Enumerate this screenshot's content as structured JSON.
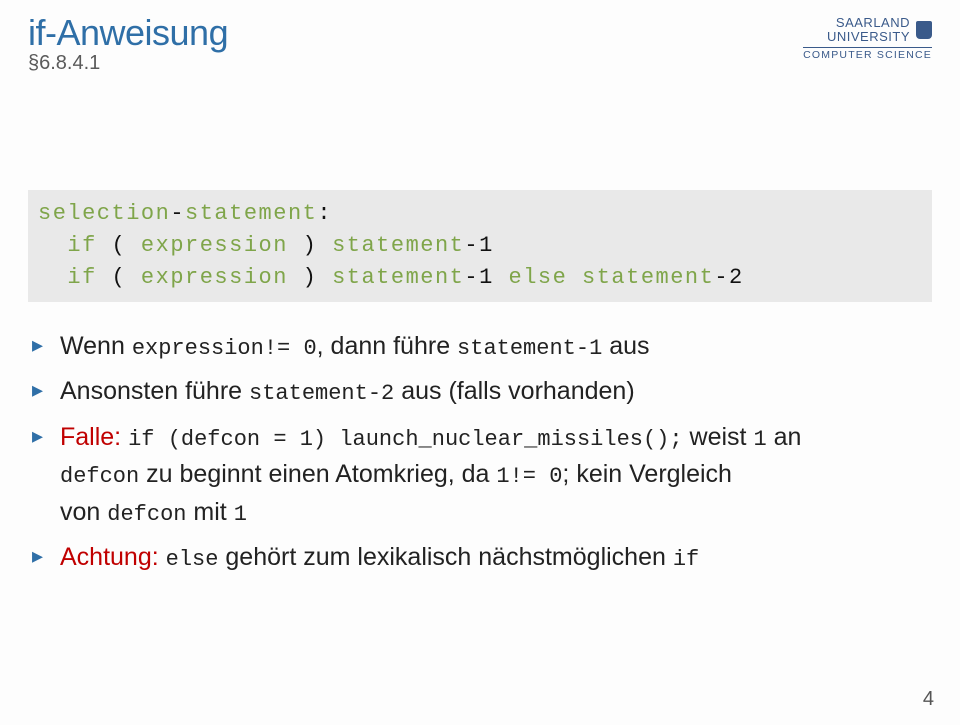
{
  "header": {
    "title": "if-Anweisung",
    "section": "§6.8.4.1"
  },
  "logo": {
    "line1a": "SAARLAND",
    "line1b": "UNIVERSITY",
    "line2": "COMPUTER SCIENCE"
  },
  "code": {
    "l1a": "selection",
    "l1b": "-",
    "l1c": "statement",
    "l1d": ":",
    "l2a": "  ",
    "l2b": "if",
    "l2c": " ( ",
    "l2d": "expression",
    "l2e": " ) ",
    "l2f": "statement",
    "l2g": "-1",
    "l3a": "  ",
    "l3b": "if",
    "l3c": " ( ",
    "l3d": "expression",
    "l3e": " ) ",
    "l3f": "statement",
    "l3g": "-1 ",
    "l3h": "else",
    "l3i": " ",
    "l3j": "statement",
    "l3k": "-2"
  },
  "bullets": {
    "b1a": "Wenn ",
    "b1b": "expression",
    "b1c": "!= 0",
    "b1d": ", dann führe ",
    "b1e": "statement-1",
    "b1f": " aus",
    "b2a": "Ansonsten führe ",
    "b2b": "statement-2",
    "b2c": " aus (falls vorhanden)",
    "b3a": "Falle:",
    "b3b": " ",
    "b3c": "if (defcon = 1) launch_nuclear_missiles();",
    "b3d": " weist ",
    "b3e": "1",
    "b3f": " an",
    "b3g": "defcon",
    "b3h": " zu beginnt einen Atomkrieg, da ",
    "b3i": "1",
    "b3j": "!= 0",
    "b3k": "; kein Vergleich",
    "b3l": "von ",
    "b3m": "defcon",
    "b3n": " mit ",
    "b3o": "1",
    "b4a": "Achtung:",
    "b4b": " ",
    "b4c": "else",
    "b4d": " gehört zum lexikalisch nächstmöglichen ",
    "b4e": "if"
  },
  "page": "4"
}
